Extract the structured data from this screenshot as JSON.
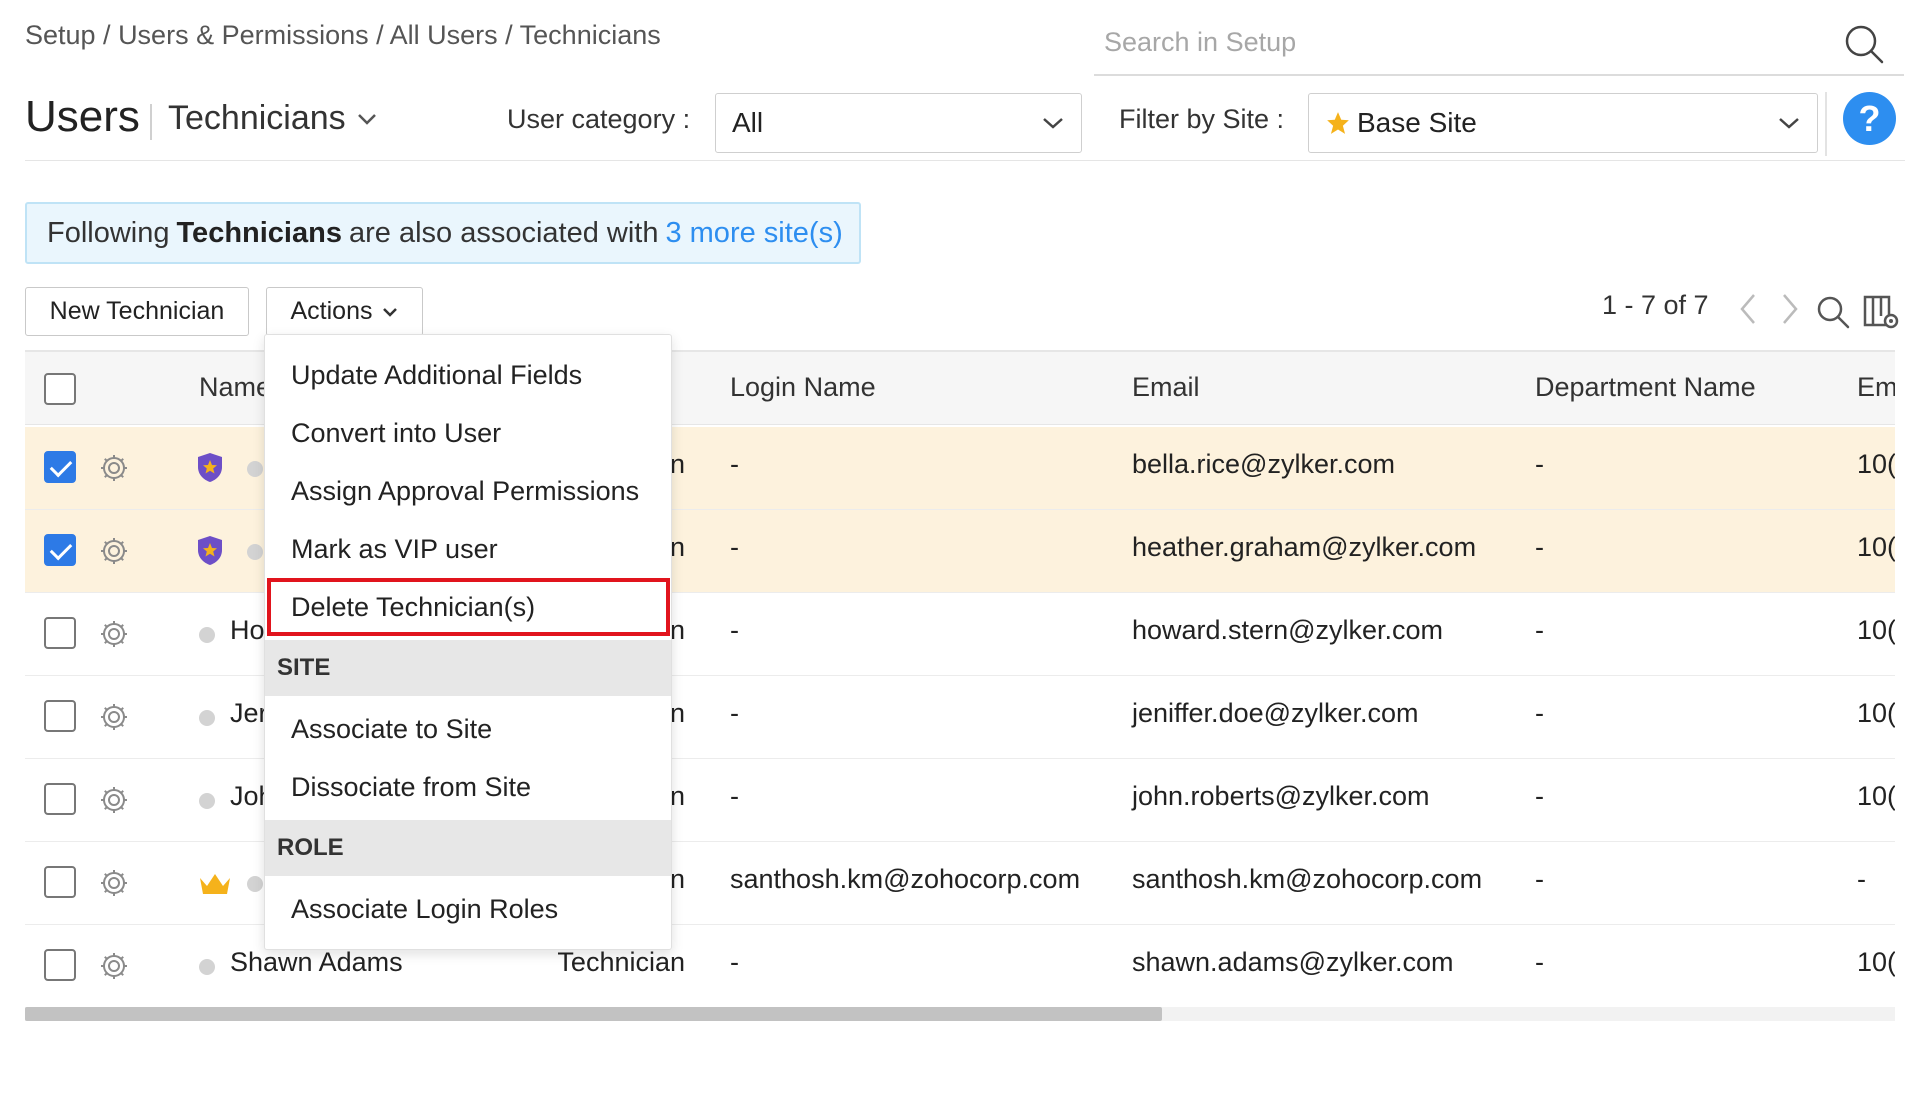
{
  "breadcrumb": "Setup / Users & Permissions / All Users / Technicians",
  "search": {
    "placeholder": "Search in Setup",
    "icon": "search-icon"
  },
  "header": {
    "title": "Users",
    "view": "Technicians",
    "user_category_label": "User category :",
    "user_category_value": "All",
    "filter_site_label": "Filter by Site :",
    "filter_site_value": "Base Site",
    "help_label": "?"
  },
  "banner": {
    "prefix": "Following",
    "bold": "Technicians",
    "middle": "are also associated with",
    "link": "3 more site(s)"
  },
  "toolbar": {
    "new_button": "New Technician",
    "actions_button": "Actions",
    "pager": "1 - 7 of 7"
  },
  "columns": {
    "name": "Name",
    "login": "Login Name",
    "email": "Email",
    "department": "Department Name",
    "employee": "Em"
  },
  "rows": [
    {
      "checked": true,
      "badge": "shield",
      "name": "",
      "role_tail": "n",
      "login": "-",
      "email": "bella.rice@zylker.com",
      "dept": "-",
      "emp": "10("
    },
    {
      "checked": true,
      "badge": "shield",
      "name": "",
      "role_tail": "n",
      "login": "-",
      "email": "heather.graham@zylker.com",
      "dept": "-",
      "emp": "10("
    },
    {
      "checked": false,
      "badge": "",
      "name": "Ho",
      "role_tail": "n",
      "login": "-",
      "email": "howard.stern@zylker.com",
      "dept": "-",
      "emp": "10("
    },
    {
      "checked": false,
      "badge": "",
      "name": "Jer",
      "role_tail": "n",
      "login": "-",
      "email": "jeniffer.doe@zylker.com",
      "dept": "-",
      "emp": "10("
    },
    {
      "checked": false,
      "badge": "",
      "name": "Joh",
      "role_tail": "n",
      "login": "-",
      "email": "john.roberts@zylker.com",
      "dept": "-",
      "emp": "10("
    },
    {
      "checked": false,
      "badge": "crown",
      "name": "",
      "role_tail": "n",
      "login": "santhosh.km@zohocorp.com",
      "email": "santhosh.km@zohocorp.com",
      "dept": "-",
      "emp": "-"
    },
    {
      "checked": false,
      "badge": "",
      "name": "Shawn Adams",
      "role_tail": "Technician",
      "login": "-",
      "email": "shawn.adams@zylker.com",
      "dept": "-",
      "emp": "10("
    }
  ],
  "actions_menu": {
    "items": [
      "Update Additional Fields",
      "Convert into User",
      "Assign Approval Permissions",
      "Mark as VIP user",
      "Delete Technician(s)"
    ],
    "site_section": "SITE",
    "site_items": [
      "Associate to Site",
      "Dissociate from Site"
    ],
    "role_section": "ROLE",
    "role_items": [
      "Associate Login Roles"
    ]
  },
  "colors": {
    "accent": "#2d8ef0",
    "selected_row": "#fdf2dd",
    "highlight_border": "#e1141d",
    "banner_bg": "#eaf6fd"
  }
}
